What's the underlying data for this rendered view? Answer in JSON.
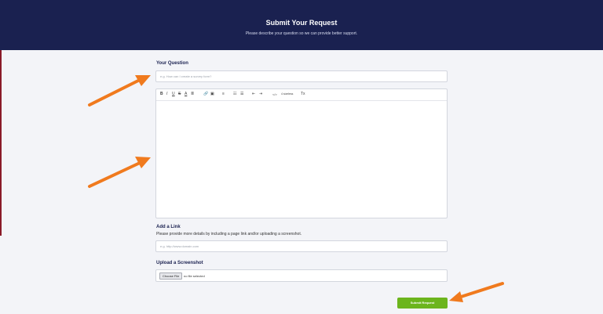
{
  "header": {
    "title": "Submit Your Request",
    "subtitle": "Please describe your question so we can provide better support."
  },
  "question": {
    "label": "Your Question",
    "placeholder": "e.g. How can I create a survey form?"
  },
  "editor": {
    "toolbar": {
      "bold": "B",
      "italic": "I",
      "underline": "U",
      "strikethrough": "S",
      "font_color": "A",
      "highlight": "≣",
      "link": "🔗",
      "image": "▣",
      "align": "≡",
      "ordered_list": "☷",
      "unordered_list": "☰",
      "outdent": "⇤",
      "indent": "⇥",
      "code": "</>",
      "font_size": "4 sizeless",
      "clear_format": "Tx"
    }
  },
  "link": {
    "label": "Add a Link",
    "help": "Please provide more details by including a page link and/or uploading a screenshot.",
    "placeholder": "e.g. http://www.domain.com"
  },
  "screenshot": {
    "label": "Upload a Screenshot",
    "choose_file": "Choose File",
    "no_file": "no file selected"
  },
  "submit_label": "Submit Request",
  "colors": {
    "header_bg": "#1a2150",
    "submit_bg": "#6cb51d",
    "arrow": "#f07a1e"
  }
}
